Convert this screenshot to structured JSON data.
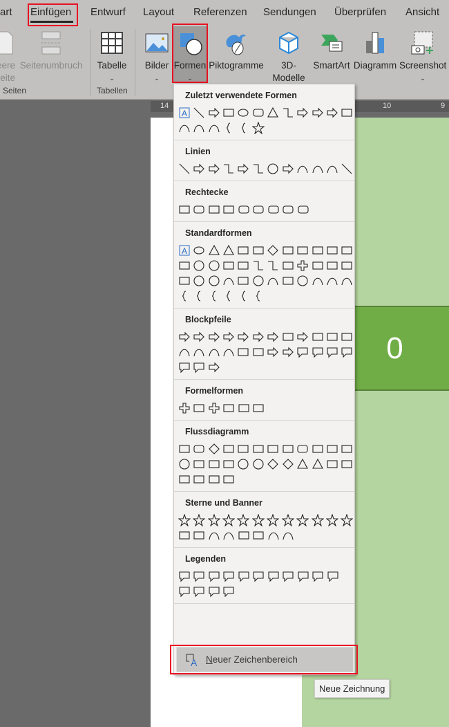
{
  "tabs": [
    {
      "label": "art"
    },
    {
      "label": "Einfügen",
      "active": true
    },
    {
      "label": "Entwurf"
    },
    {
      "label": "Layout"
    },
    {
      "label": "Referenzen"
    },
    {
      "label": "Sendungen"
    },
    {
      "label": "Überprüfen"
    },
    {
      "label": "Ansicht"
    }
  ],
  "ribbon": {
    "leere_seite": "eere\neite",
    "seitenumbruch": "Seitenumbruch",
    "group_seiten": "Seiten",
    "tabelle": "Tabelle",
    "group_tabellen": "Tabellen",
    "bilder": "Bilder",
    "formen": "Formen",
    "piktogramme": "Piktogramme",
    "modelle": "3D-\nModelle",
    "smartart": "SmartArt",
    "diagramm": "Diagramm",
    "screenshot": "Screenshot"
  },
  "ruler": {
    "left": "14",
    "mid": "10",
    "right": "9"
  },
  "document": {
    "cell_value": "0"
  },
  "menu": {
    "sections": [
      {
        "title": "Zuletzt verwendete Formen",
        "rows": [
          [
            "textbox",
            "line",
            "arrow-line",
            "rect",
            "oval",
            "roundrect",
            "triangle",
            "elbow",
            "elbow-arrow",
            "right-arrow",
            "down-arrow",
            "flowchart-card"
          ],
          [
            "freeform",
            "arc",
            "curve",
            "brace-left",
            "brace-right",
            "star"
          ]
        ]
      },
      {
        "title": "Linien",
        "rows": [
          [
            "line",
            "arrow-line",
            "double-arrow",
            "elbow",
            "elbow-arrow",
            "elbow-double",
            "curve-connector",
            "curve-arrow",
            "curve-double",
            "curve",
            "freeform",
            "scribble"
          ]
        ]
      },
      {
        "title": "Rechtecke",
        "rows": [
          [
            "rect",
            "roundrect",
            "snip1",
            "snip2",
            "snip-round",
            "round1",
            "round2",
            "round-diag",
            "roundrect"
          ]
        ]
      },
      {
        "title": "Standardformen",
        "rows": [
          [
            "textbox",
            "oval",
            "triangle",
            "right-triangle",
            "parallelogram",
            "trapezoid",
            "diamond",
            "pentagon",
            "hexagon",
            "heptagon",
            "octagon",
            "decagon"
          ],
          [
            "dodecagon",
            "pie",
            "chord",
            "teardrop",
            "frame",
            "half-frame",
            "L-shape",
            "diag-stripe",
            "cross",
            "plaque",
            "can",
            "cube"
          ],
          [
            "bevel",
            "donut",
            "no-symbol",
            "block-arc",
            "folded",
            "smiley",
            "heart",
            "bolt",
            "sun",
            "moon",
            "cloud",
            "arc"
          ],
          [
            "bracket-pair",
            "brace-pair",
            "bracket-left",
            "bracket-right",
            "brace-left",
            "brace-right"
          ]
        ]
      },
      {
        "title": "Blockpfeile",
        "rows": [
          [
            "right-arrow",
            "left-arrow",
            "up-arrow",
            "down-arrow",
            "left-right-arrow",
            "up-down-arrow",
            "quad-arrow",
            "left-right-up",
            "bent-arrow",
            "u-turn",
            "left-up",
            "bent-up"
          ],
          [
            "curved-right",
            "curved-left",
            "curved-up",
            "curved-down",
            "striped-right",
            "notched-right",
            "pentagon-arrow",
            "chevron",
            "right-callout",
            "down-callout",
            "left-callout",
            "up-callout"
          ],
          [
            "up-down-callout",
            "quad-callout",
            "circular-arrow"
          ]
        ]
      },
      {
        "title": "Formelformen",
        "rows": [
          [
            "plus",
            "minus",
            "multiply",
            "divide",
            "equal",
            "not-equal"
          ]
        ]
      },
      {
        "title": "Flussdiagramm",
        "rows": [
          [
            "process",
            "alt-process",
            "decision",
            "data",
            "predefined",
            "internal-storage",
            "document",
            "multidoc",
            "terminator",
            "preparation",
            "manual-input",
            "manual-op"
          ],
          [
            "connector",
            "offpage",
            "card",
            "punched-tape",
            "summing",
            "or",
            "collate",
            "sort",
            "extract",
            "merge",
            "stored-data",
            "delay"
          ],
          [
            "sequential",
            "magnetic-disk",
            "direct-access",
            "display"
          ]
        ]
      },
      {
        "title": "Sterne und Banner",
        "rows": [
          [
            "explosion1",
            "explosion2",
            "star4",
            "star5",
            "star6",
            "star7",
            "star8",
            "star10",
            "star12",
            "star16",
            "star24",
            "star32"
          ],
          [
            "ribbon-up",
            "ribbon-down",
            "curved-ribbon-up",
            "curved-ribbon-down",
            "scroll-v",
            "scroll-h",
            "wave",
            "double-wave"
          ]
        ]
      },
      {
        "title": "Legenden",
        "rows": [
          [
            "callout-rect",
            "callout-round",
            "callout-oval",
            "callout-cloud",
            "line-callout1",
            "line-callout2",
            "line-callout3",
            "line-callout4",
            "accent-callout1",
            "accent-callout2",
            "accent-callout3"
          ],
          [
            "accent-callout4",
            "border-callout1",
            "border-callout2",
            "border-callout3"
          ]
        ]
      }
    ],
    "new_canvas": {
      "mnemonic": "N",
      "label": "euer Zeichenbereich"
    }
  },
  "tooltip": "Neue Zeichnung",
  "colors": {
    "highlight": "#e81123",
    "accent_blue": "#4472c4",
    "green": "#70ad47",
    "light_green": "#b5d5a0"
  }
}
